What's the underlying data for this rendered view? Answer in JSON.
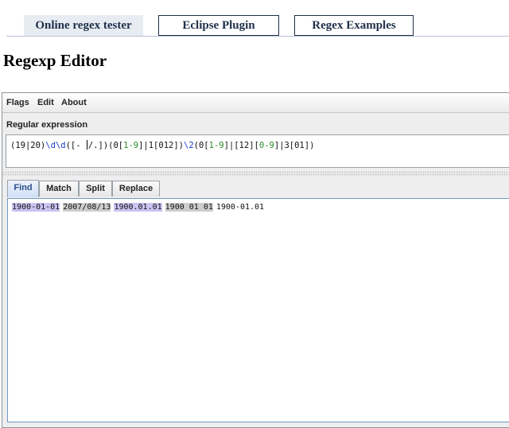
{
  "nav": {
    "tabs": [
      {
        "label": "Online regex tester",
        "active": true
      },
      {
        "label": "Eclipse Plugin",
        "active": false
      },
      {
        "label": "Regex Examples",
        "active": false
      }
    ]
  },
  "page": {
    "title": "Regexp Editor"
  },
  "app": {
    "menu": [
      "Flags",
      "Edit",
      "About"
    ],
    "regex_label": "Regular expression",
    "regex_parts": [
      {
        "text": "(19|20)",
        "color": "black"
      },
      {
        "text": "\\d\\d",
        "color": "blue"
      },
      {
        "text": "([- ",
        "color": "black"
      },
      {
        "text": "/.",
        "color": "black"
      },
      {
        "text": "])(0[",
        "color": "black"
      },
      {
        "text": "1-9",
        "color": "green"
      },
      {
        "text": "]|1[012])",
        "color": "black"
      },
      {
        "text": "\\2",
        "color": "blue"
      },
      {
        "text": "(0[",
        "color": "black"
      },
      {
        "text": "1-9",
        "color": "green"
      },
      {
        "text": "]|[12][",
        "color": "black"
      },
      {
        "text": "0-9",
        "color": "green"
      },
      {
        "text": "]|3[01])",
        "color": "black"
      }
    ],
    "tabs": [
      "Find",
      "Match",
      "Split",
      "Replace"
    ],
    "selected_tab": "Find",
    "results": [
      {
        "text": "1900-01-01",
        "highlight": "purple"
      },
      {
        "text": "2007/08/13",
        "highlight": "gray"
      },
      {
        "text": "1900.01.01",
        "highlight": "purple"
      },
      {
        "text": "1900 01 01",
        "highlight": "gray"
      },
      {
        "text": "1900-01.01",
        "highlight": "none"
      }
    ]
  },
  "colors": {
    "match_a": "#c9c4f2",
    "match_b": "#cdcdcd",
    "regex_green": "#2a8c2a",
    "regex_blue": "#1a3fc4"
  }
}
